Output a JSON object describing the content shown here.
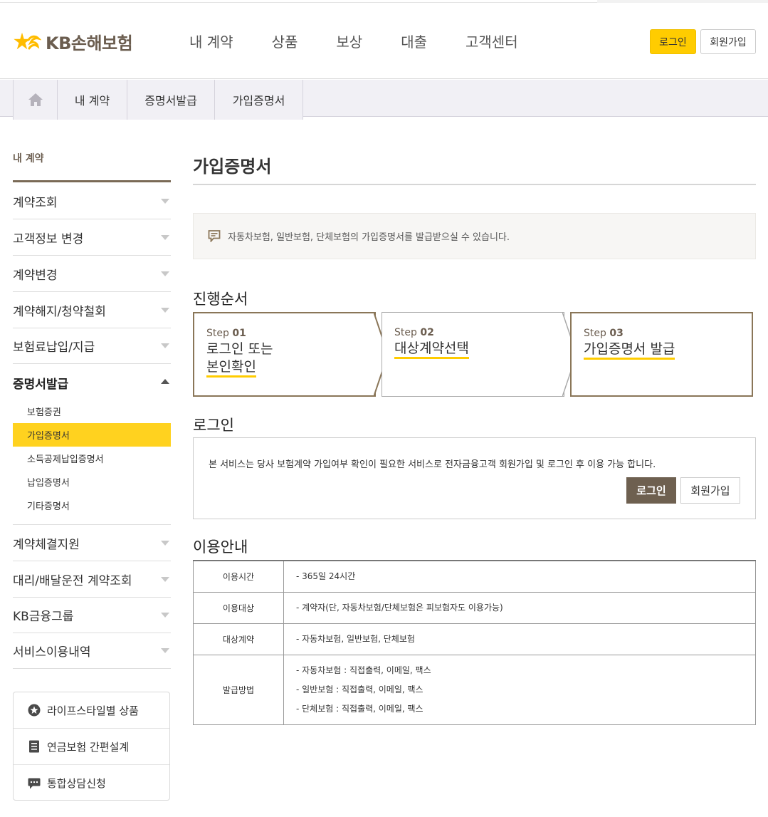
{
  "header": {
    "logo_text": "KB손해보험",
    "nav": [
      "내 계약",
      "상품",
      "보상",
      "대출",
      "고객센터"
    ],
    "login_label": "로그인",
    "join_label": "회원가입",
    "brand_color": "#ffcc00"
  },
  "breadcrumb": {
    "home_icon": "home-icon",
    "items": [
      "내 계약",
      "증명서발급",
      "가입증명서"
    ]
  },
  "sidebar": {
    "title": "내 계약",
    "items": [
      {
        "label": "계약조회"
      },
      {
        "label": "고객정보 변경"
      },
      {
        "label": "계약변경"
      },
      {
        "label": "계약해지/청약철회"
      },
      {
        "label": "보험료납입/지급"
      },
      {
        "label": "증명서발급",
        "expanded": true
      }
    ],
    "sub_items": [
      "보험증권",
      "가입증명서",
      "소득공제납입증명서",
      "납입증명서",
      "기타증명서"
    ],
    "active_sub": "가입증명서",
    "items_after": [
      {
        "label": "계약체결지원"
      },
      {
        "label": "대리/배달운전 계약조회"
      },
      {
        "label": "KB금융그룹"
      },
      {
        "label": "서비스이용내역"
      }
    ],
    "quick_links": [
      {
        "icon": "star-circle-icon",
        "label": "라이프스타일별 상품"
      },
      {
        "icon": "document-icon",
        "label": "연금보험 간편설계"
      },
      {
        "icon": "chat-bubble-icon",
        "label": "통합상담신청"
      }
    ]
  },
  "main": {
    "title": "가입증명서",
    "notice": "자동차보험, 일반보험, 단체보험의 가입증명서를 발급받으실 수 있습니다.",
    "steps_title": "진행순서",
    "steps": [
      {
        "prefix": "Step",
        "num": "01",
        "line1": "로그인 또는",
        "line2": "본인확인"
      },
      {
        "prefix": "Step",
        "num": "02",
        "line1": "대상계약선택",
        "line2": ""
      },
      {
        "prefix": "Step",
        "num": "03",
        "line1": "가입증명서 발급",
        "line2": ""
      }
    ],
    "login_title": "로그인",
    "login_text": "본 서비스는 당사 보험계약 가입여부 확인이 필요한 서비스로 전자금융고객 회원가입 및 로그인 후 이용 가능 합니다.",
    "login_button": "로그인",
    "join_button": "회원가입",
    "usage_title": "이용안내",
    "usage_rows": [
      {
        "label": "이용시간",
        "lines": [
          "- 365일 24시간"
        ]
      },
      {
        "label": "이용대상",
        "lines": [
          "- 계약자(단, 자동차보험/단체보험은 피보험자도 이용가능)"
        ]
      },
      {
        "label": "대상계약",
        "lines": [
          "- 자동차보험, 일반보험, 단체보험"
        ]
      },
      {
        "label": "발급방법",
        "lines": [
          "- 자동차보험 : 직접출력, 이메일, 팩스",
          "- 일반보험 : 직접출력, 이메일, 팩스",
          "- 단체보험 : 직접출력, 이메일, 팩스"
        ]
      }
    ]
  }
}
